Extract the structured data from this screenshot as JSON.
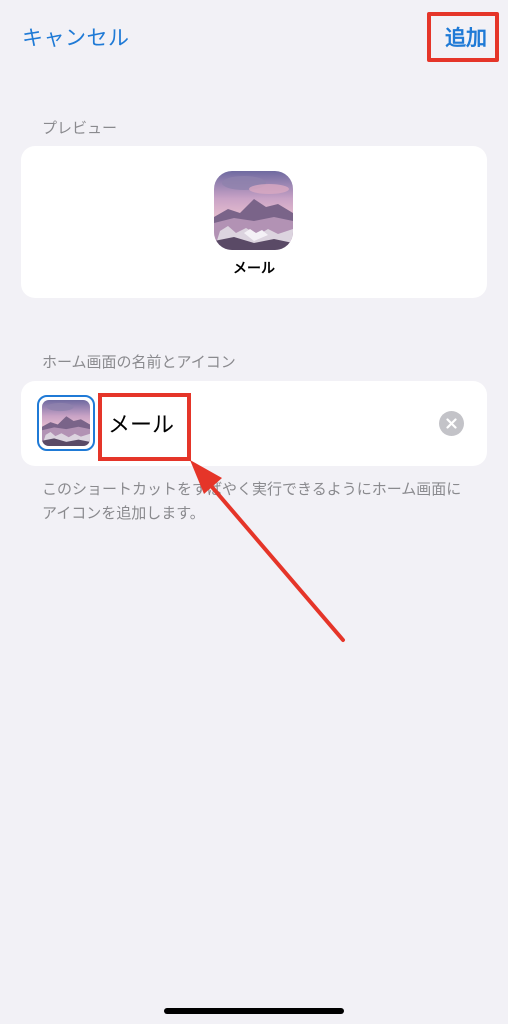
{
  "nav": {
    "cancel_label": "キャンセル",
    "add_label": "追加"
  },
  "preview": {
    "section_label": "プレビュー",
    "icon_name": "メール"
  },
  "home_screen": {
    "section_label": "ホーム画面の名前とアイコン",
    "name_value": "メール",
    "footnote": "このショートカットをすばやく実行できるようにホーム画面にアイコンを追加します。"
  },
  "colors": {
    "accent": "#1f7ad6",
    "highlight": "#e53529",
    "background": "#f2f1f6"
  },
  "icons": {
    "thumbnail": "landscape-thumbnail-icon",
    "clear": "clear-x-icon"
  }
}
